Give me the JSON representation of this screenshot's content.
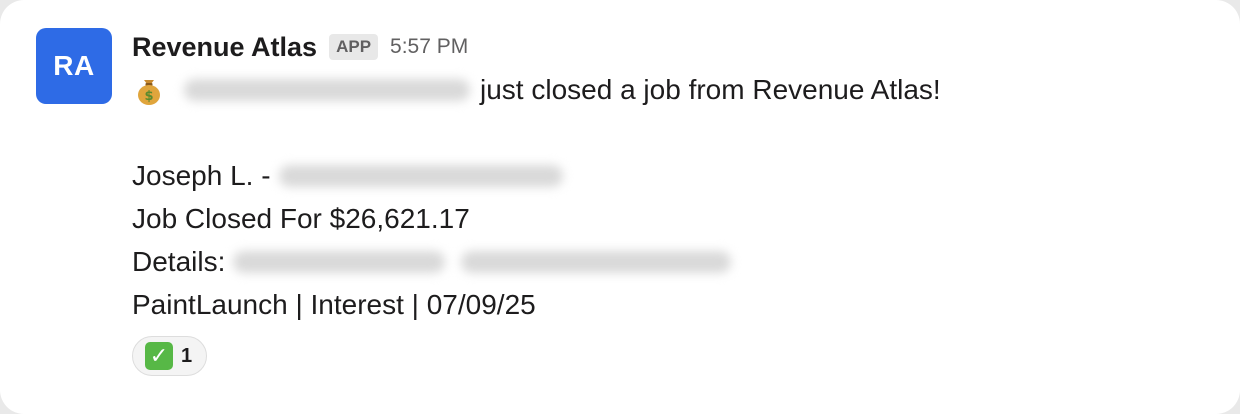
{
  "colors": {
    "avatar_bg": "#2e6be6",
    "check_bg": "#57b846"
  },
  "message": {
    "avatar_initials": "RA",
    "sender": "Revenue Atlas",
    "badge": "APP",
    "time": "5:57 PM",
    "headline_icon": "money-bag-icon",
    "headline_text": "just closed a job from Revenue Atlas!",
    "rep_label": "Joseph L. -",
    "job_closed": "Job Closed For $26,621.17",
    "details_label": "Details:",
    "source_line": "PaintLaunch | Interest | 07/09/25"
  },
  "reaction": {
    "icon": "white-check-mark-icon",
    "count": "1"
  }
}
